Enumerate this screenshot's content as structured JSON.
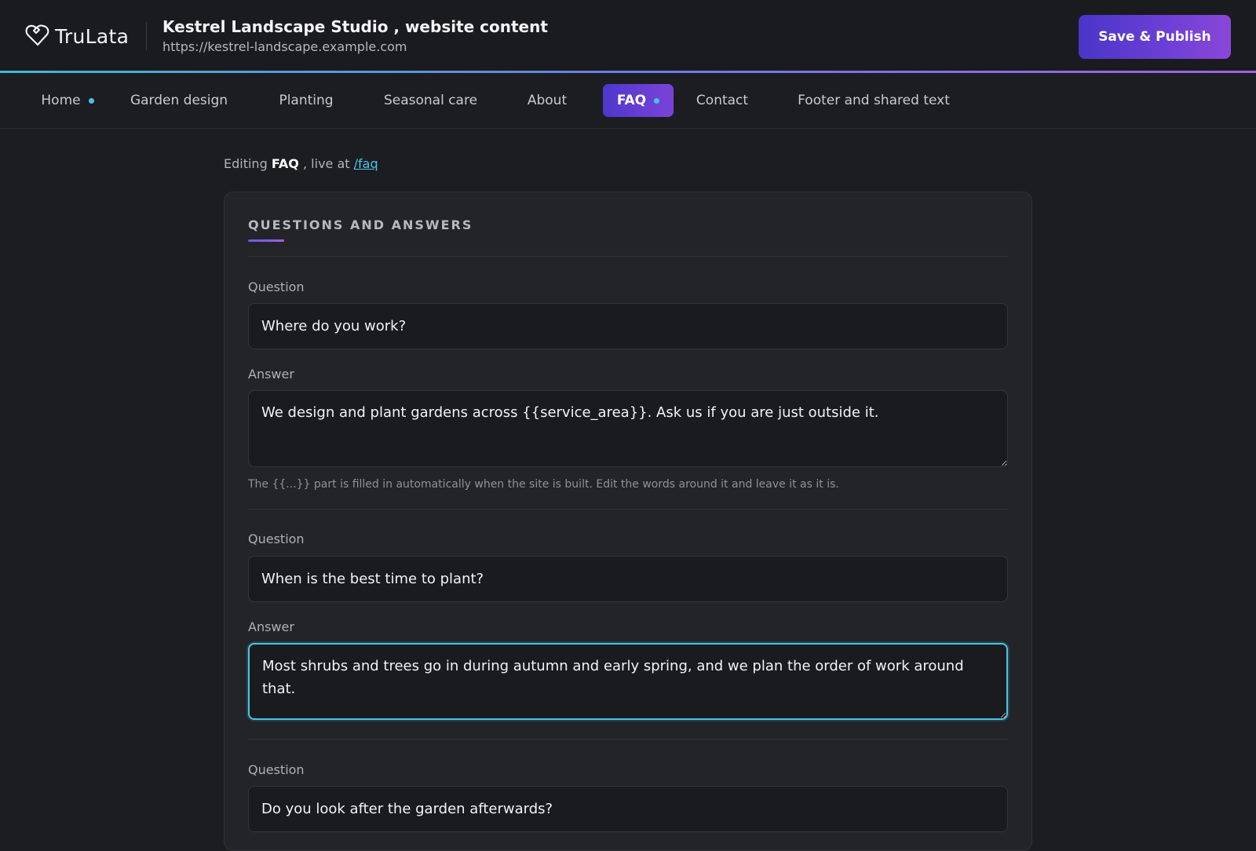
{
  "app": {
    "logo_text": "TruLata",
    "site_title": "Kestrel Landscape Studio , website content",
    "site_url": "https://kestrel-landscape.example.com",
    "publish_label": "Save & Publish"
  },
  "nav": {
    "tabs": [
      {
        "label": "Home",
        "has_dot": true,
        "active": false
      },
      {
        "label": "Garden design",
        "has_dot": false,
        "active": false
      },
      {
        "label": "Planting",
        "has_dot": false,
        "active": false
      },
      {
        "label": "Seasonal care",
        "has_dot": false,
        "active": false
      },
      {
        "label": "About",
        "has_dot": false,
        "active": false
      },
      {
        "label": "FAQ",
        "has_dot": true,
        "active": true
      },
      {
        "label": "Contact",
        "has_dot": false,
        "active": false
      },
      {
        "label": "Footer and shared text",
        "has_dot": false,
        "active": false
      }
    ]
  },
  "editing": {
    "prefix": "Editing",
    "page_name": "FAQ",
    "middle": ", live at",
    "path": "/faq"
  },
  "section": {
    "title": "QUESTIONS AND ANSWERS",
    "question_label": "Question",
    "answer_label": "Answer",
    "items": [
      {
        "question": "Where do you work?",
        "answer": "We design and plant gardens across {{service_area}}. Ask us if you are just outside it.",
        "hint": "The {{...}} part is filled in automatically when the site is built. Edit the words around it and leave it as it is."
      },
      {
        "question": "When is the best time to plant?",
        "answer": "Most shrubs and trees go in during autumn and early spring, and we plan the order of work around that."
      },
      {
        "question": "Do you look after the garden afterwards?"
      }
    ]
  },
  "colors": {
    "accent_cyan": "#45c6e6",
    "accent_purple": "#6e3fd6",
    "background": "#1c1d21"
  }
}
